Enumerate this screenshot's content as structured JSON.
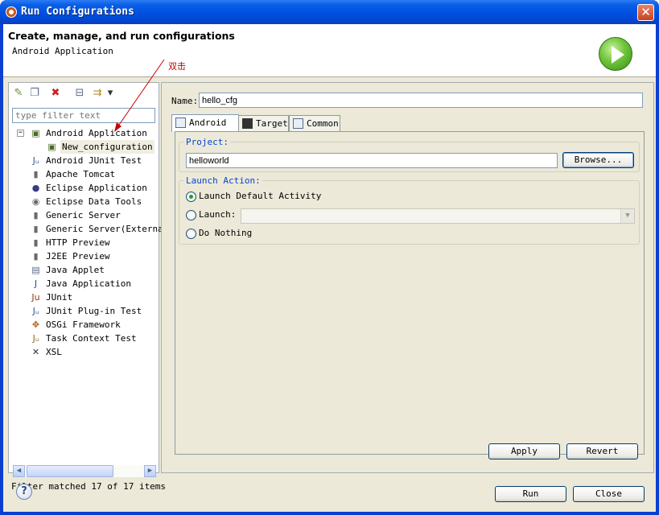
{
  "window": {
    "title": "Run Configurations",
    "close_icon": "close-icon"
  },
  "header": {
    "title": "Create, manage, and run configurations",
    "subtitle": "Android Application",
    "logo_icon": "run-play-icon"
  },
  "annotation": {
    "text": "双击",
    "color": "#c80000"
  },
  "left": {
    "toolbar": [
      {
        "name": "new-configuration-icon",
        "glyph": "✎"
      },
      {
        "name": "duplicate-icon",
        "glyph": "❐"
      },
      {
        "name": "delete-icon",
        "glyph": "✖"
      },
      {
        "name": "collapse-all-icon",
        "glyph": "⊟"
      },
      {
        "name": "filter-icon",
        "glyph": "⇉"
      },
      {
        "name": "view-menu-icon",
        "glyph": "▾"
      }
    ],
    "filter_placeholder": "type filter text",
    "tree": [
      {
        "label": "Android Application",
        "icon": "android-app-icon",
        "glyph": "▣",
        "expanded": true,
        "level": 0
      },
      {
        "label": "New_configuration",
        "icon": "android-config-icon",
        "glyph": "▣",
        "level": 1,
        "selected": true
      },
      {
        "label": "Android JUnit Test",
        "icon": "android-junit-icon",
        "glyph": "Jᵤ",
        "level": 0
      },
      {
        "label": "Apache Tomcat",
        "icon": "server-icon",
        "glyph": "▮",
        "level": 0
      },
      {
        "label": "Eclipse Application",
        "icon": "eclipse-icon",
        "glyph": "●",
        "level": 0
      },
      {
        "label": "Eclipse Data Tools",
        "icon": "database-icon",
        "glyph": "◉",
        "level": 0
      },
      {
        "label": "Generic Server",
        "icon": "server-icon",
        "glyph": "▮",
        "level": 0
      },
      {
        "label": "Generic Server(External",
        "icon": "server-icon",
        "glyph": "▮",
        "level": 0
      },
      {
        "label": "HTTP Preview",
        "icon": "server-icon",
        "glyph": "▮",
        "level": 0
      },
      {
        "label": "J2EE Preview",
        "icon": "server-icon",
        "glyph": "▮",
        "level": 0
      },
      {
        "label": "Java Applet",
        "icon": "java-applet-icon",
        "glyph": "▤",
        "level": 0
      },
      {
        "label": "Java Application",
        "icon": "java-app-icon",
        "glyph": "J",
        "level": 0
      },
      {
        "label": "JUnit",
        "icon": "junit-icon",
        "glyph": "Ju",
        "level": 0
      },
      {
        "label": "JUnit Plug-in Test",
        "icon": "junit-plugin-icon",
        "glyph": "Jᵤ",
        "level": 0
      },
      {
        "label": "OSGi Framework",
        "icon": "osgi-icon",
        "glyph": "✥",
        "level": 0
      },
      {
        "label": "Task Context Test",
        "icon": "task-context-icon",
        "glyph": "Jᵤ",
        "level": 0
      },
      {
        "label": "XSL",
        "icon": "xsl-icon",
        "glyph": "✕",
        "level": 0
      }
    ],
    "filter_status": "Filter matched 17 of 17 items"
  },
  "right": {
    "name_label": "Name:",
    "name_value": "hello_cfg",
    "tabs": [
      {
        "label": "Android",
        "icon": "android-tab-icon",
        "active": true
      },
      {
        "label": "Target",
        "icon": "target-tab-icon",
        "active": false
      },
      {
        "label": "Common",
        "icon": "common-tab-icon",
        "active": false
      }
    ],
    "project": {
      "group_label": "Project:",
      "value": "helloworld",
      "browse_label": "Browse..."
    },
    "launch": {
      "group_label": "Launch Action:",
      "options": [
        {
          "label": "Launch Default Activity",
          "checked": true
        },
        {
          "label": "Launch:",
          "checked": false
        },
        {
          "label": "Do Nothing",
          "checked": false
        }
      ],
      "activity_value": ""
    },
    "apply_label": "Apply",
    "revert_label": "Revert"
  },
  "footer": {
    "run_label": "Run",
    "close_label": "Close",
    "help_icon": "help-icon"
  }
}
